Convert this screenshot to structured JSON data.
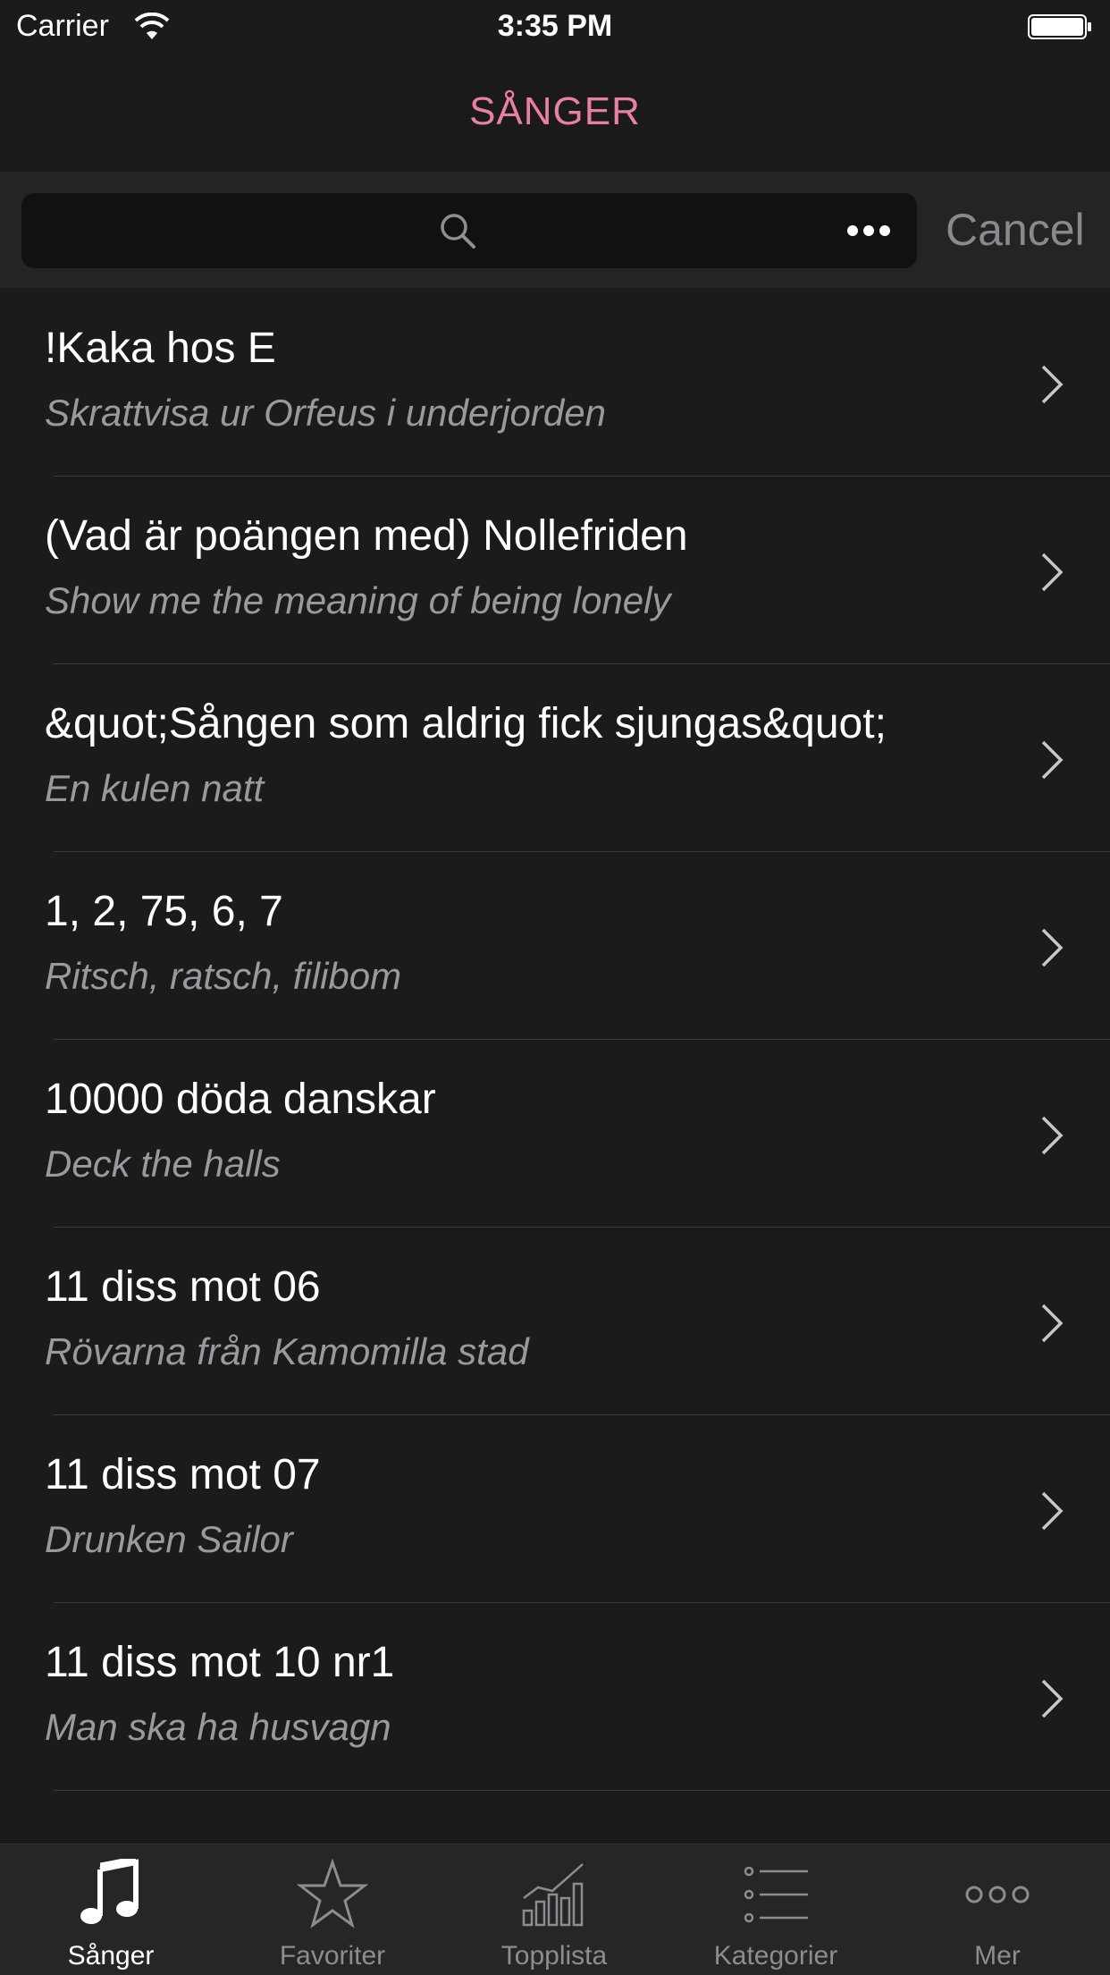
{
  "status_bar": {
    "carrier": "Carrier",
    "time": "3:35 PM"
  },
  "nav": {
    "title": "SÅNGER"
  },
  "search": {
    "placeholder": "",
    "cancel_label": "Cancel"
  },
  "songs": [
    {
      "title": "!Kaka hos E",
      "melody": "Skrattvisa ur Orfeus i underjorden"
    },
    {
      "title": "(Vad är poängen med) Nollefriden",
      "melody": "Show me the meaning of being lonely"
    },
    {
      "title": "&quot;Sången som aldrig fick sjungas&quot;",
      "melody": "En kulen natt"
    },
    {
      "title": "1, 2, 75, 6, 7",
      "melody": "Ritsch, ratsch, filibom"
    },
    {
      "title": "10000 döda danskar",
      "melody": "Deck the halls"
    },
    {
      "title": "11 diss mot 06",
      "melody": "Rövarna från Kamomilla stad"
    },
    {
      "title": "11 diss mot 07",
      "melody": "Drunken Sailor"
    },
    {
      "title": "11 diss mot 10 nr1",
      "melody": "Man ska ha husvagn"
    }
  ],
  "tabs": [
    {
      "label": "Sånger",
      "icon": "music-note-icon",
      "active": true
    },
    {
      "label": "Favoriter",
      "icon": "star-icon",
      "active": false
    },
    {
      "label": "Topplista",
      "icon": "chart-icon",
      "active": false
    },
    {
      "label": "Kategorier",
      "icon": "list-icon",
      "active": false
    },
    {
      "label": "Mer",
      "icon": "more-dots-icon",
      "active": false
    }
  ],
  "colors": {
    "accent": "#e97fa4",
    "background": "#1b1b1c"
  }
}
